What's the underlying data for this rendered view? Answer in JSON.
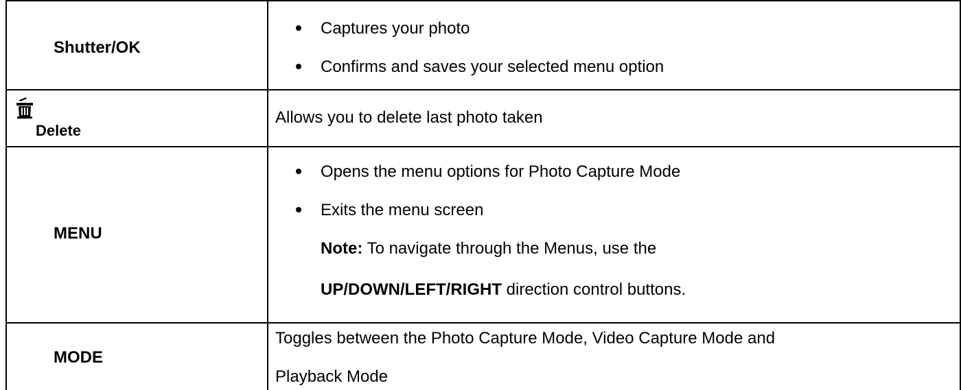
{
  "rows": [
    {
      "key": "Shutter/OK",
      "bullets": [
        "Captures your photo",
        "Confirms and saves your selected menu option"
      ]
    },
    {
      "key_icon": "trash-icon",
      "key": "Delete",
      "text": "Allows you to delete last photo taken"
    },
    {
      "key": "MENU",
      "bullets": [
        "Opens the menu options for Photo Capture Mode",
        "Exits the menu screen"
      ],
      "note_label": "Note:",
      "note_text": " To navigate through the Menus, use the",
      "note_bold": "UP/DOWN/LEFT/RIGHT",
      "note_tail": " direction control buttons."
    },
    {
      "key": "MODE",
      "text_line1": "Toggles between the Photo Capture Mode, Video Capture Mode and",
      "text_line2": "Playback Mode"
    }
  ]
}
